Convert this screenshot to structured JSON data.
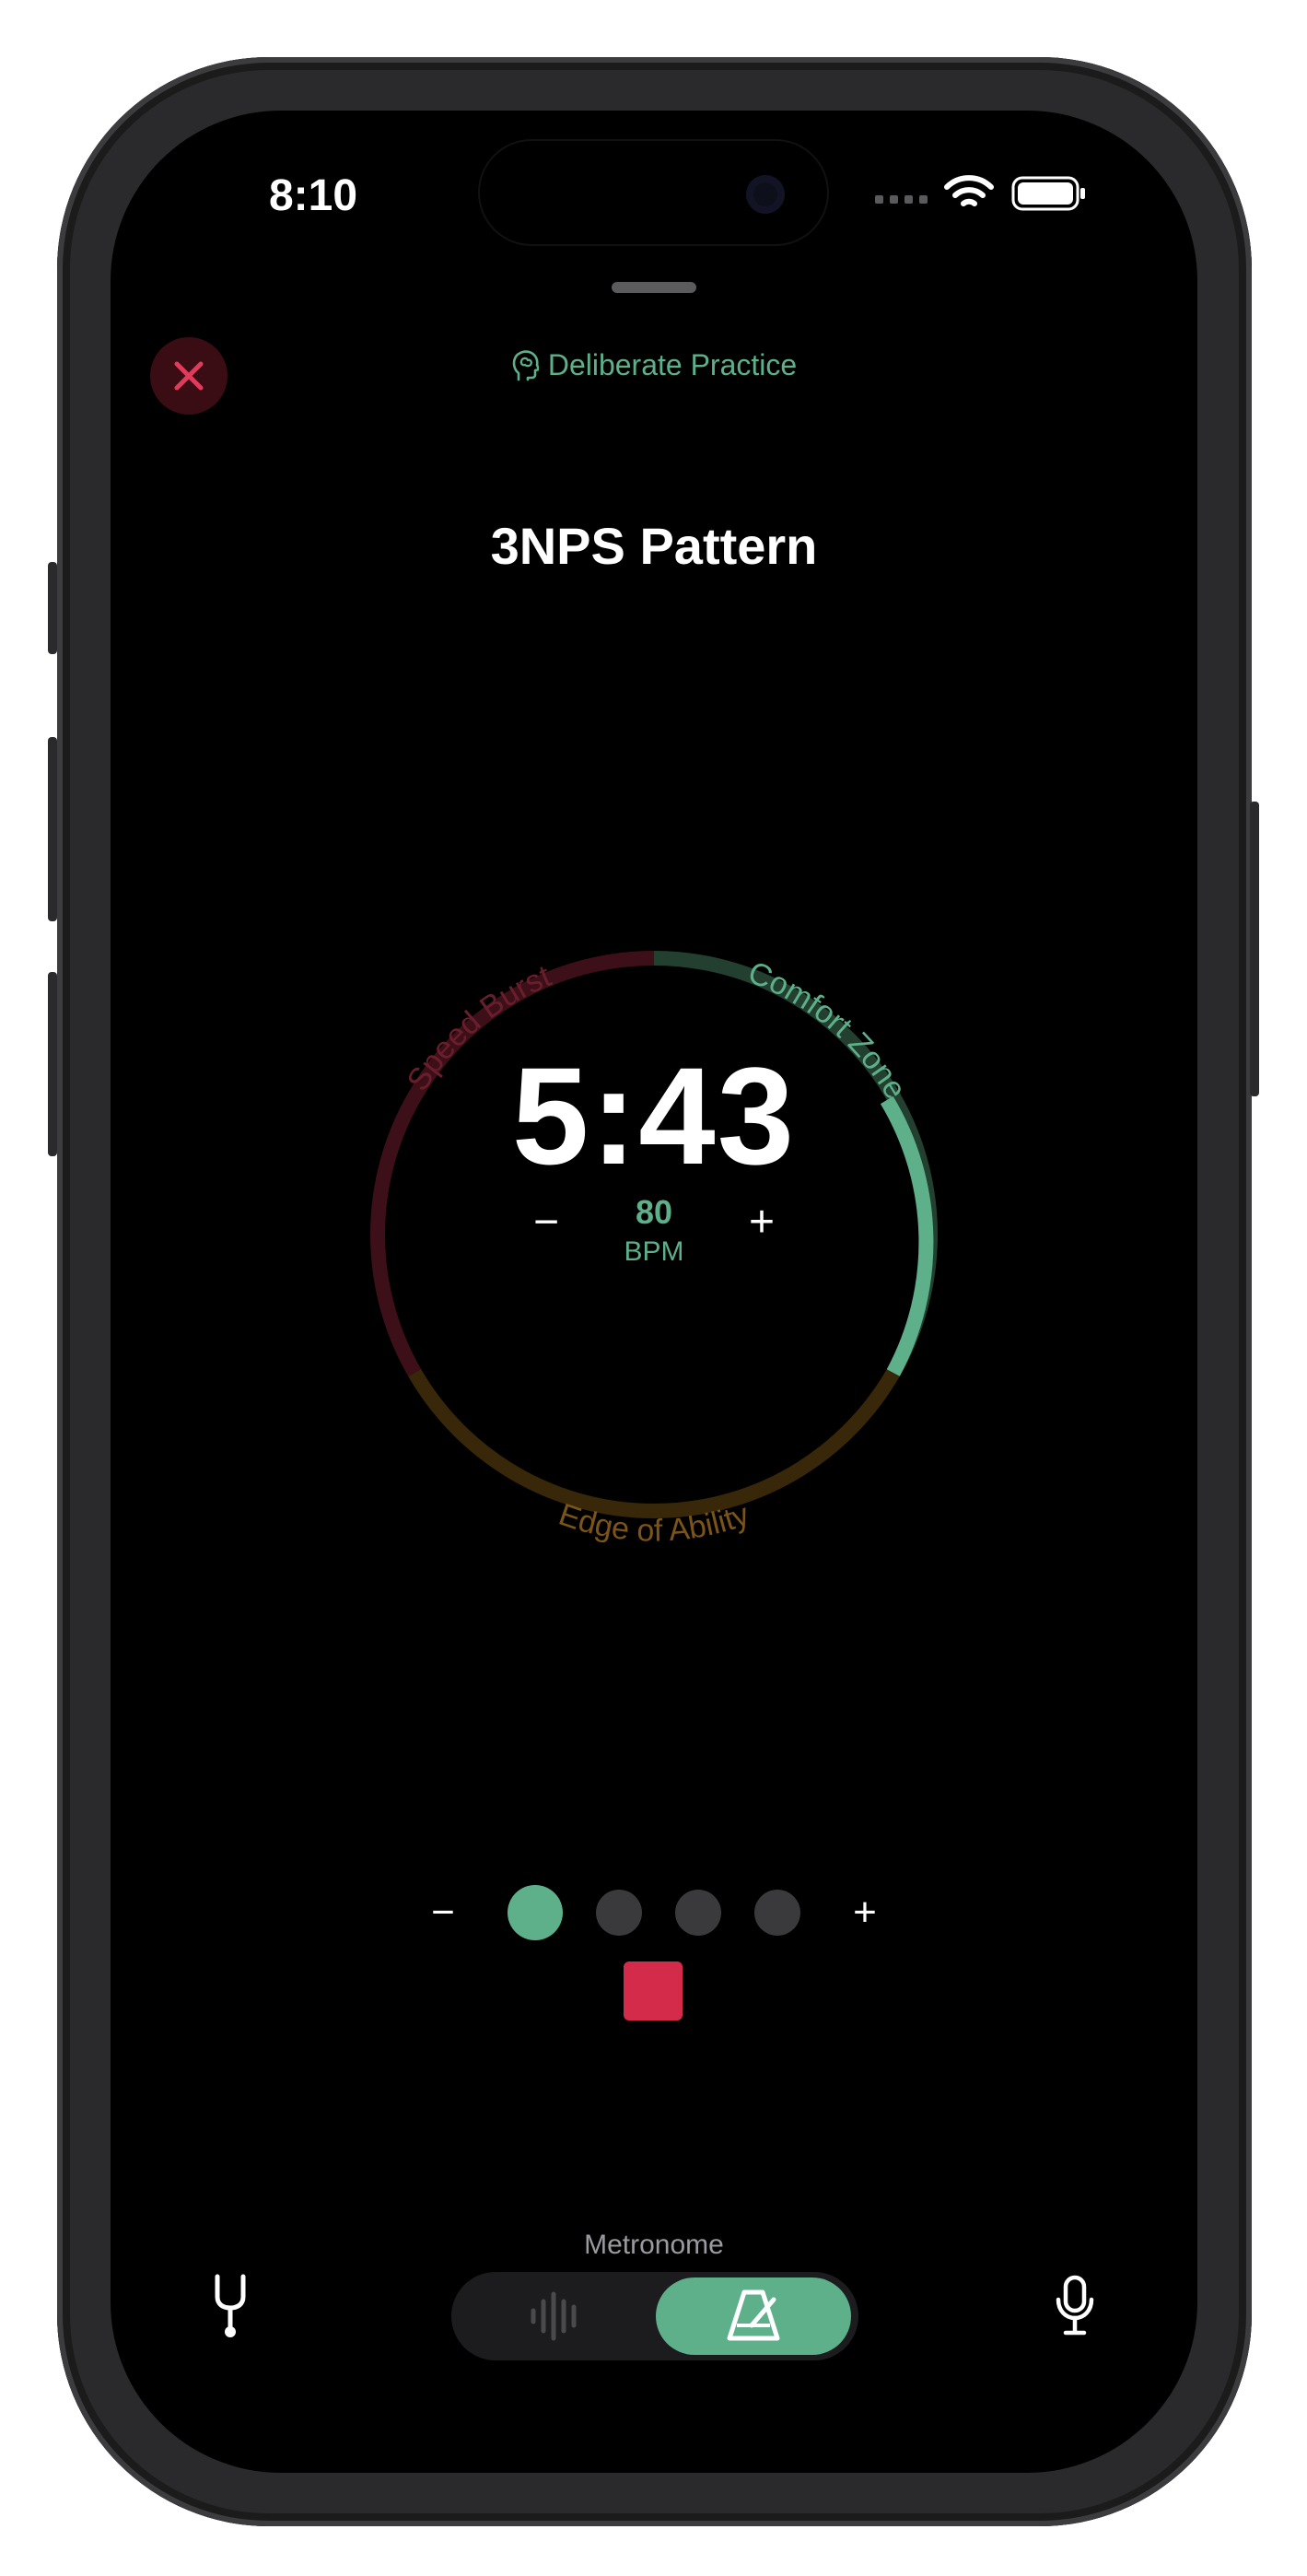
{
  "status_bar": {
    "time": "8:10"
  },
  "header": {
    "mode_label": "Deliberate Practice"
  },
  "exercise": {
    "title": "3NPS Pattern"
  },
  "dial": {
    "zones": [
      {
        "name": "Speed Burst",
        "color": "#d52b4b"
      },
      {
        "name": "Comfort Zone",
        "color": "#5eb08a"
      },
      {
        "name": "Edge of Ability",
        "color": "#a36a15"
      }
    ],
    "active_zone": "Comfort Zone"
  },
  "timer": {
    "value": "5:43"
  },
  "tempo": {
    "value": "80",
    "unit": "BPM",
    "minus": "−",
    "plus": "+"
  },
  "steps": {
    "minus": "−",
    "plus": "+",
    "count": 4,
    "active_index": 0
  },
  "bottom": {
    "caption": "Metronome"
  },
  "colors": {
    "accent": "#5eb08a",
    "stop": "#d52b4b",
    "close_bg": "#3a0d15"
  },
  "icons": {
    "close": "close-icon",
    "mode": "brain-icon",
    "tuner": "tuning-fork-icon",
    "waveform": "waveform-icon",
    "metronome": "metronome-icon",
    "mic": "mic-icon"
  }
}
